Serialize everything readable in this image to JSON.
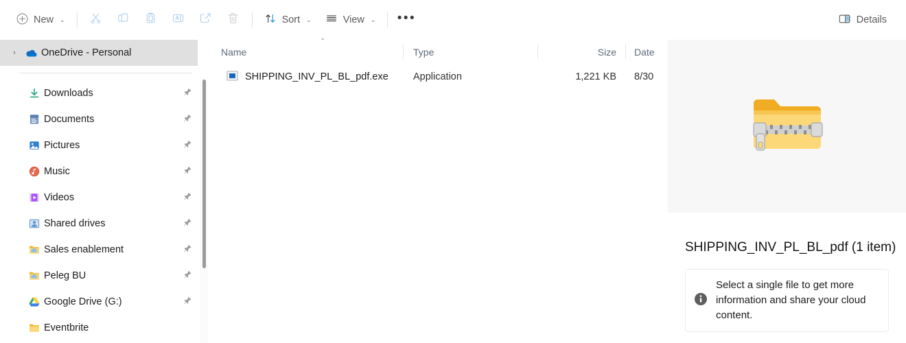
{
  "toolbar": {
    "new_label": "New",
    "new_caret": "⌄",
    "cut_label": "Cut",
    "copy_label": "Copy",
    "paste_label": "Paste",
    "rename_label": "Rename",
    "share_label": "Share",
    "delete_label": "Delete",
    "sort_label": "Sort",
    "sort_caret": "⌄",
    "view_label": "View",
    "view_caret": "⌄",
    "overflow_label": "•••",
    "details_label": "Details"
  },
  "sidebar": {
    "root": {
      "label": "OneDrive - Personal",
      "chevron": "›",
      "icon": "onedrive-cloud-icon"
    },
    "items": [
      {
        "label": "Downloads",
        "icon": "download-arrow-icon",
        "pinned": true
      },
      {
        "label": "Documents",
        "icon": "documents-icon",
        "pinned": true
      },
      {
        "label": "Pictures",
        "icon": "pictures-icon",
        "pinned": true
      },
      {
        "label": "Music",
        "icon": "music-note-icon",
        "pinned": true
      },
      {
        "label": "Videos",
        "icon": "videos-icon",
        "pinned": true
      },
      {
        "label": "Shared drives",
        "icon": "shared-drives-icon",
        "pinned": true
      },
      {
        "label": "Sales enablement",
        "icon": "cloud-folder-icon",
        "pinned": true
      },
      {
        "label": "Peleg BU",
        "icon": "cloud-folder-icon",
        "pinned": true
      },
      {
        "label": "Google Drive (G:)",
        "icon": "google-drive-icon",
        "pinned": true
      },
      {
        "label": "Eventbrite",
        "icon": "folder-icon",
        "pinned": false
      }
    ]
  },
  "filelist": {
    "columns": [
      "Name",
      "Type",
      "Size",
      "Date"
    ],
    "sort_indicator": "⌃",
    "rows": [
      {
        "name": "SHIPPING_INV_PL_BL_pdf.exe",
        "type": "Application",
        "size": "1,221 KB",
        "date": "8/30",
        "icon": "application-exe-icon"
      }
    ]
  },
  "details": {
    "preview_icon": "zipped-folder-icon",
    "title": "SHIPPING_INV_PL_BL_pdf (1 item)",
    "info_icon": "info-circle-icon",
    "info_text": "Select a single file to get more information and share your cloud content."
  },
  "colors": {
    "accent_blue": "#0f6cbd",
    "onedrive_blue": "#0364b8",
    "folder_yellow": "#f5c242",
    "selection_grey": "#e0e0e0",
    "panel_grey": "#f7f7f7"
  }
}
